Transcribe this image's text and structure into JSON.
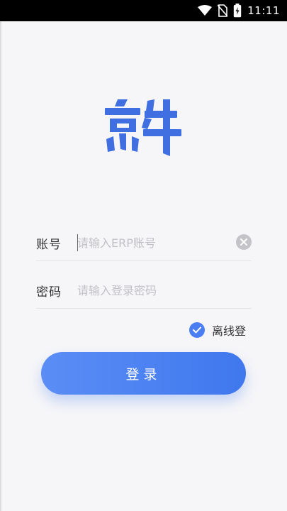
{
  "status_bar": {
    "time": "11:11",
    "icons": [
      "wifi-icon",
      "no-sim-icon",
      "battery-charging-icon"
    ]
  },
  "logo": {
    "icon": "jingniu-logo",
    "color": "#3f6fe0",
    "text": "京牛"
  },
  "account": {
    "label": "账号",
    "placeholder": "请输入ERP账号",
    "value": ""
  },
  "password": {
    "label": "密码",
    "placeholder": "请输入登录密码",
    "value": ""
  },
  "offline_login": {
    "label": "离线登",
    "checked": true
  },
  "login_button": {
    "label": "登录"
  },
  "colors": {
    "accent": "#4a7ef2",
    "background": "#f6f6f8"
  }
}
